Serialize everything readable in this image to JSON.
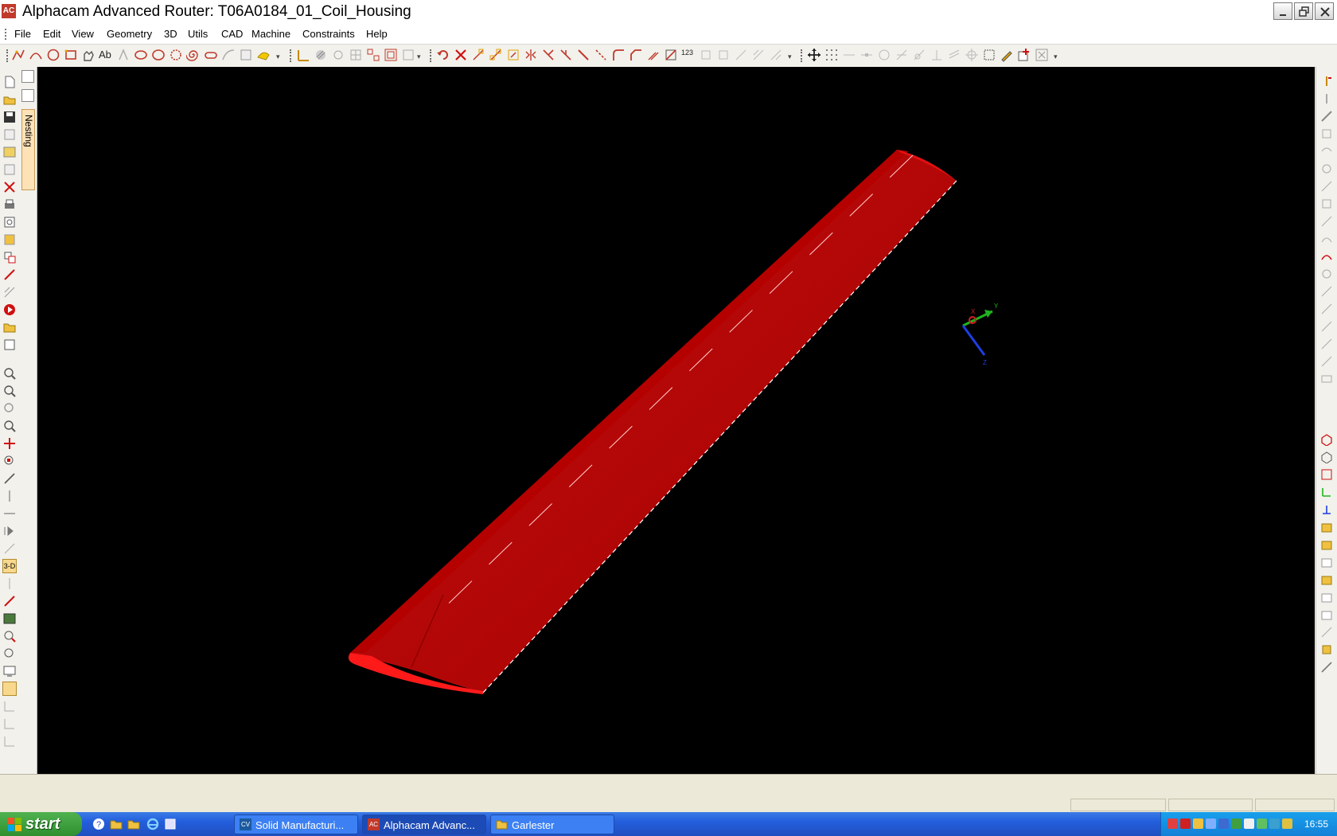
{
  "window": {
    "app_icon": "AC",
    "title": "Alphacam Advanced Router: T06A0184_01_Coil_Housing"
  },
  "menu": [
    {
      "label": "File"
    },
    {
      "label": "Edit"
    },
    {
      "label": "View"
    },
    {
      "label": "Geometry"
    },
    {
      "label": "3D"
    },
    {
      "label": "Utils"
    },
    {
      "label": "CAD"
    },
    {
      "label": "Machine"
    },
    {
      "label": "Constraints"
    },
    {
      "label": "Help"
    }
  ],
  "toolbar": {
    "text_tool": "Ab",
    "number_tool": "123"
  },
  "side_panel": {
    "tab_label": "Nesting",
    "view_3d_label": "3-D"
  },
  "axes": {
    "x_label": "X",
    "y_label": "Y",
    "z_label": "Z",
    "colors": {
      "x": "#d21f1f",
      "y": "#1fb41f",
      "z": "#1f3ee0"
    }
  },
  "model": {
    "color": "#b00000",
    "highlight": "#c81010"
  },
  "taskbar": {
    "start_label": "start",
    "tasks": [
      {
        "icon": "CV",
        "label": "Solid Manufacturi..."
      },
      {
        "icon": "AC",
        "label": "Alphacam Advanc...",
        "active": true
      },
      {
        "icon": "folder-icon",
        "label": "Garlester"
      }
    ],
    "clock": "16:55"
  }
}
